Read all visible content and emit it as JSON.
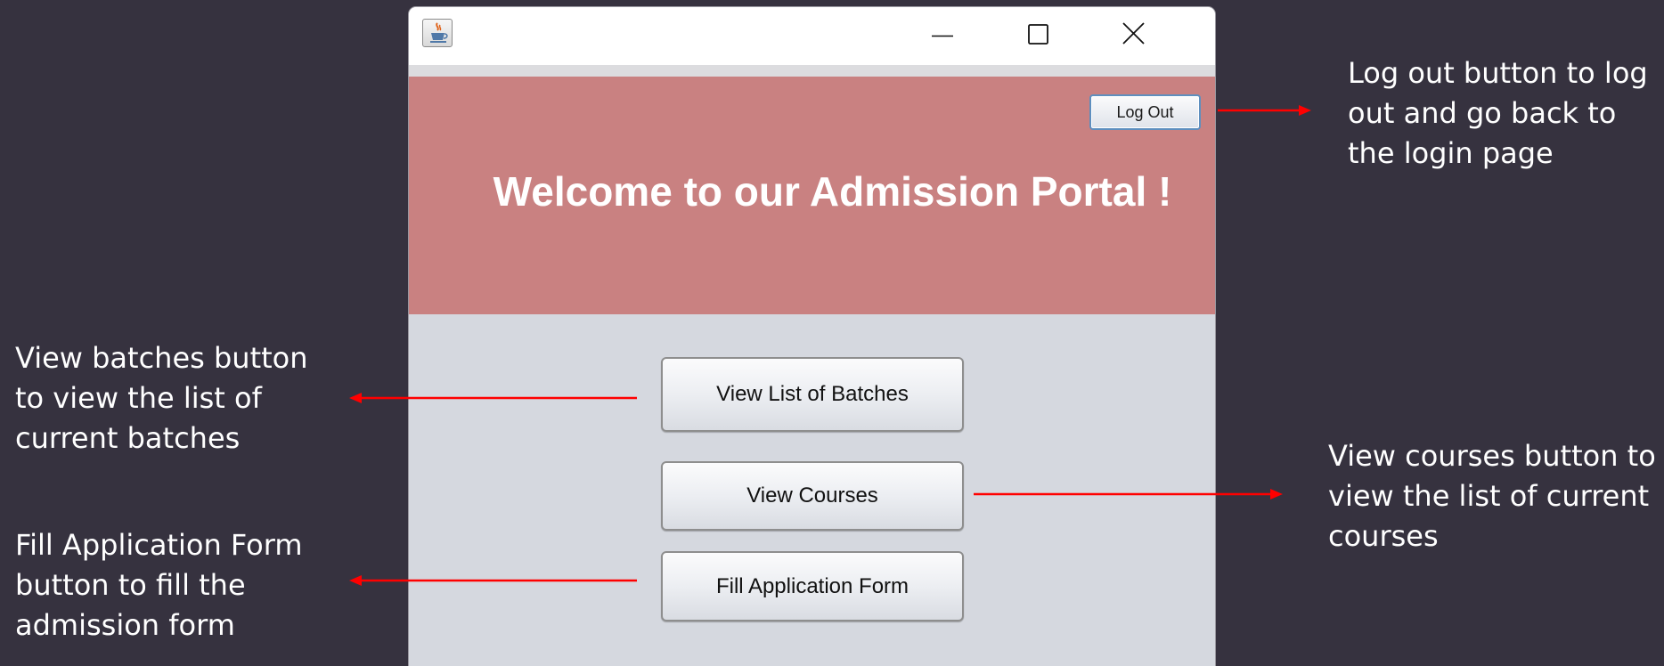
{
  "window": {
    "minimize_icon": "minimize-icon",
    "maximize_icon": "maximize-icon",
    "close_icon": "close-icon",
    "app_icon": "java-coffee-cup-icon"
  },
  "header": {
    "logout_label": "Log Out",
    "welcome_text": "Welcome to our Admission Portal !",
    "background_color": "#c98181"
  },
  "main": {
    "batches_label": "View List of Batches",
    "courses_label": "View Courses",
    "fill_form_label": "Fill Application Form"
  },
  "annotations": {
    "logout": "Log out button to log out and go back to the login page",
    "batches": "View batches button to view the list of current batches",
    "courses": "View courses button to view the list of current courses",
    "fill_form": "Fill Application Form button to fill the admission form",
    "arrow_color": "#ff0000"
  }
}
